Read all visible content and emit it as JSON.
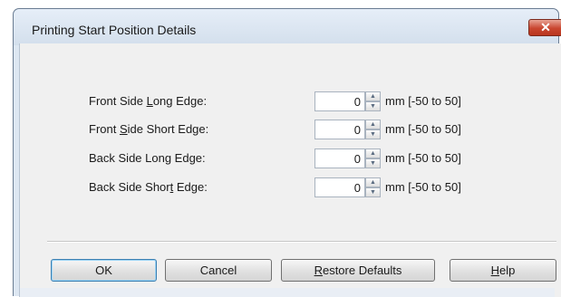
{
  "dialog": {
    "title": "Printing Start Position Details",
    "close_glyph": "✕"
  },
  "fields": [
    {
      "label_before": "Front Side ",
      "label_key": "L",
      "label_after": "ong Edge:",
      "value": "0",
      "range": "mm [-50 to 50]"
    },
    {
      "label_before": "Front ",
      "label_key": "S",
      "label_after": "ide Short Edge:",
      "value": "0",
      "range": "mm [-50 to 50]"
    },
    {
      "label_before": "Back Side Long Edge:",
      "label_key": "",
      "label_after": "",
      "value": "0",
      "range": "mm [-50 to 50]"
    },
    {
      "label_before": "Back Side Shor",
      "label_key": "t",
      "label_after": " Edge:",
      "value": "0",
      "range": "mm [-50 to 50]"
    }
  ],
  "spinner": {
    "up_glyph": "▲",
    "down_glyph": "▼"
  },
  "buttons": {
    "ok": "OK",
    "cancel": "Cancel",
    "restore_key": "R",
    "restore_rest": "estore Defaults",
    "help_key": "H",
    "help_rest": "elp"
  }
}
